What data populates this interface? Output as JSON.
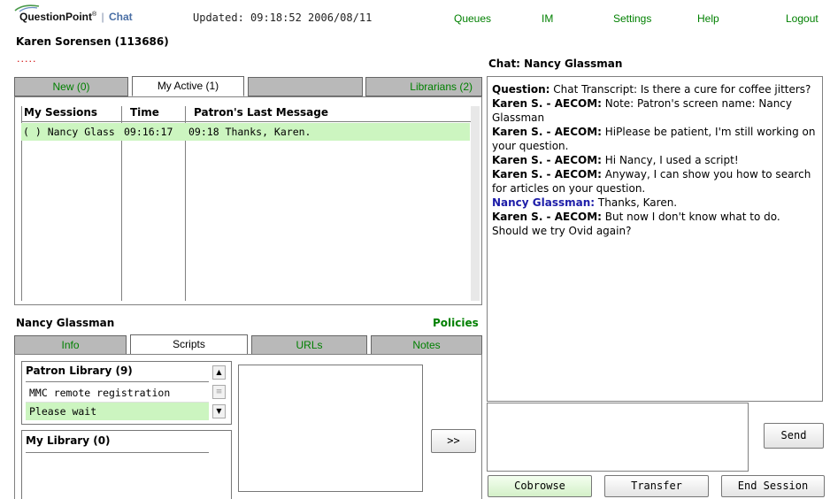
{
  "header": {
    "brand_name": "QuestionPoint",
    "brand_trademark": "®",
    "brand_separator": "|",
    "brand_product": "Chat",
    "updated": "Updated: 09:18:52 2006/08/11",
    "nav": {
      "queues": "Queues",
      "im": "IM",
      "settings": "Settings",
      "help": "Help",
      "logout": "Logout"
    },
    "agent": "Karen Sorensen (113686)",
    "indicator_dots": "....."
  },
  "session_tabs": {
    "new": "New (0)",
    "my_active": "My Active (1)",
    "blank": "",
    "librarians": "Librarians (2)"
  },
  "sessions_table": {
    "columns": [
      "My Sessions",
      "Time",
      "Patron's Last Message"
    ],
    "rows": [
      {
        "session": "( ) Nancy Glass",
        "time": "09:16:17",
        "last_message": "09:18 Thanks, Karen."
      }
    ]
  },
  "patron_panel": {
    "name": "Nancy Glassman",
    "policies_link": "Policies",
    "tabs": {
      "info": "Info",
      "scripts": "Scripts",
      "urls": "URLs",
      "notes": "Notes"
    },
    "patron_library": {
      "header": "Patron Library (9)",
      "items": [
        "MMC remote registration",
        "Please wait"
      ]
    },
    "my_library": {
      "header": "My Library (0)"
    },
    "insert_button": ">>"
  },
  "chat": {
    "title": "Chat: Nancy Glassman",
    "transcript": [
      {
        "speaker": "Question:",
        "text": " Chat Transcript: Is there a cure for coffee jitters?"
      },
      {
        "speaker": "Karen S. - AECOM:",
        "text": " Note: Patron's screen name: Nancy Glassman"
      },
      {
        "speaker": "Karen S. - AECOM:",
        "text": " HiPlease be patient, I'm still working on your question."
      },
      {
        "speaker": "Karen S. - AECOM:",
        "text": " Hi Nancy, I used a script!"
      },
      {
        "speaker": "Karen S. - AECOM:",
        "text": " Anyway, I can show you how to search for articles on your question."
      },
      {
        "speaker": "Nancy Glassman:",
        "text": " Thanks, Karen."
      },
      {
        "speaker": "Karen S. - AECOM:",
        "text": " But now I don't know what to do. Should we try Ovid again?"
      }
    ],
    "reply_value": "",
    "send_button": "Send",
    "cobrowse_button": "Cobrowse",
    "transfer_button": "Transfer",
    "end_session_button": "End Session"
  },
  "colors": {
    "link_green": "#008000",
    "selection_green": "#ccf5c0",
    "tab_gray": "#b9b9b9",
    "patron_blue": "#1c1ca8",
    "brand_blue": "#4a6fa5"
  },
  "icons": {
    "logo": "questionpoint-swoosh-icon",
    "scroll_up": "scroll-up-arrow-icon",
    "scroll_down": "scroll-down-arrow-icon",
    "scroll_thumb": "scroll-thumb-grip-icon"
  }
}
